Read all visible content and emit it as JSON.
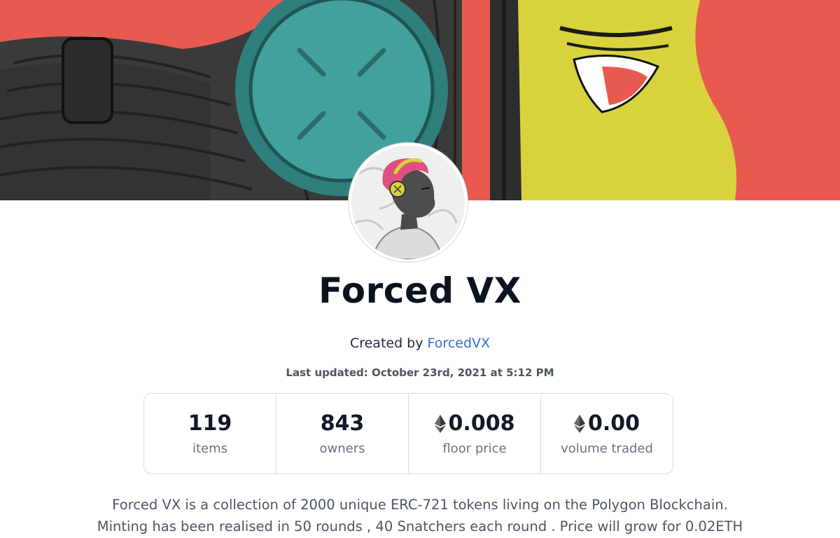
{
  "collection": {
    "title": "Forced VX",
    "created_by_label": "Created by",
    "creator_name": "ForcedVX",
    "last_updated_label": "Last updated:",
    "last_updated_value": "October 23rd, 2021 at 5:12 PM"
  },
  "stats": [
    {
      "value": "119",
      "label": "items",
      "icon": ""
    },
    {
      "value": "843",
      "label": "owners",
      "icon": ""
    },
    {
      "value": "0.008",
      "label": "floor price",
      "icon": "ethereum-icon"
    },
    {
      "value": "0.00",
      "label": "volume traded",
      "icon": "ethereum-icon"
    }
  ],
  "description": {
    "line1": "Forced VX is a collection of 2000 unique ERC-721 tokens living on the Polygon Blockchain.",
    "line2": "Minting has been realised in 50 rounds , 40 Snatchers each round . Price will grow for 0.02ETH"
  },
  "colors": {
    "banner_bg": "#e85a50",
    "headphone_teal": "#3f9a96",
    "face_yellow": "#d8d33d",
    "hair_dark": "#3a3a3a",
    "link_blue": "#2f6fd6"
  }
}
